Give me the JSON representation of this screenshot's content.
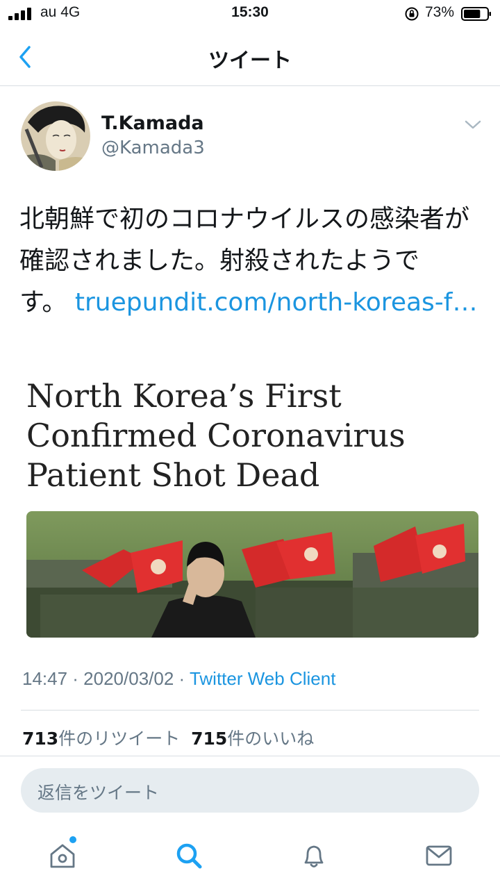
{
  "status_bar": {
    "carrier": "au  4G",
    "time": "15:30",
    "battery_percent": "73%",
    "battery_level": 0.73
  },
  "nav": {
    "title": "ツイート"
  },
  "tweet": {
    "display_name": "T.Kamada",
    "handle": "@Kamada3",
    "text": "北朝鮮で初のコロナウイルスの感染者が確認されました。射殺されたようです。",
    "link_text": "truepundit.com/north-koreas-f…",
    "card_title": "North Korea’s First Confirmed Coronavirus Patient Shot Dead",
    "timestamp": "14:47 · 2020/03/02 · ",
    "source": "Twitter Web Client",
    "retweets_count": "713",
    "retweets_label": "件のリツイート",
    "likes_count": "715",
    "likes_label": "件のいいね"
  },
  "reply": {
    "placeholder": "返信をツイート"
  },
  "icons": {
    "back": "chevron-left-icon",
    "more": "chevron-down-icon",
    "home": "home-icon",
    "search": "search-icon",
    "notifications": "bell-icon",
    "messages": "envelope-icon"
  },
  "colors": {
    "accent": "#1da1f2",
    "link": "#1b95e0",
    "secondary_text": "#657786",
    "reply_bg": "#e6ecf0"
  }
}
